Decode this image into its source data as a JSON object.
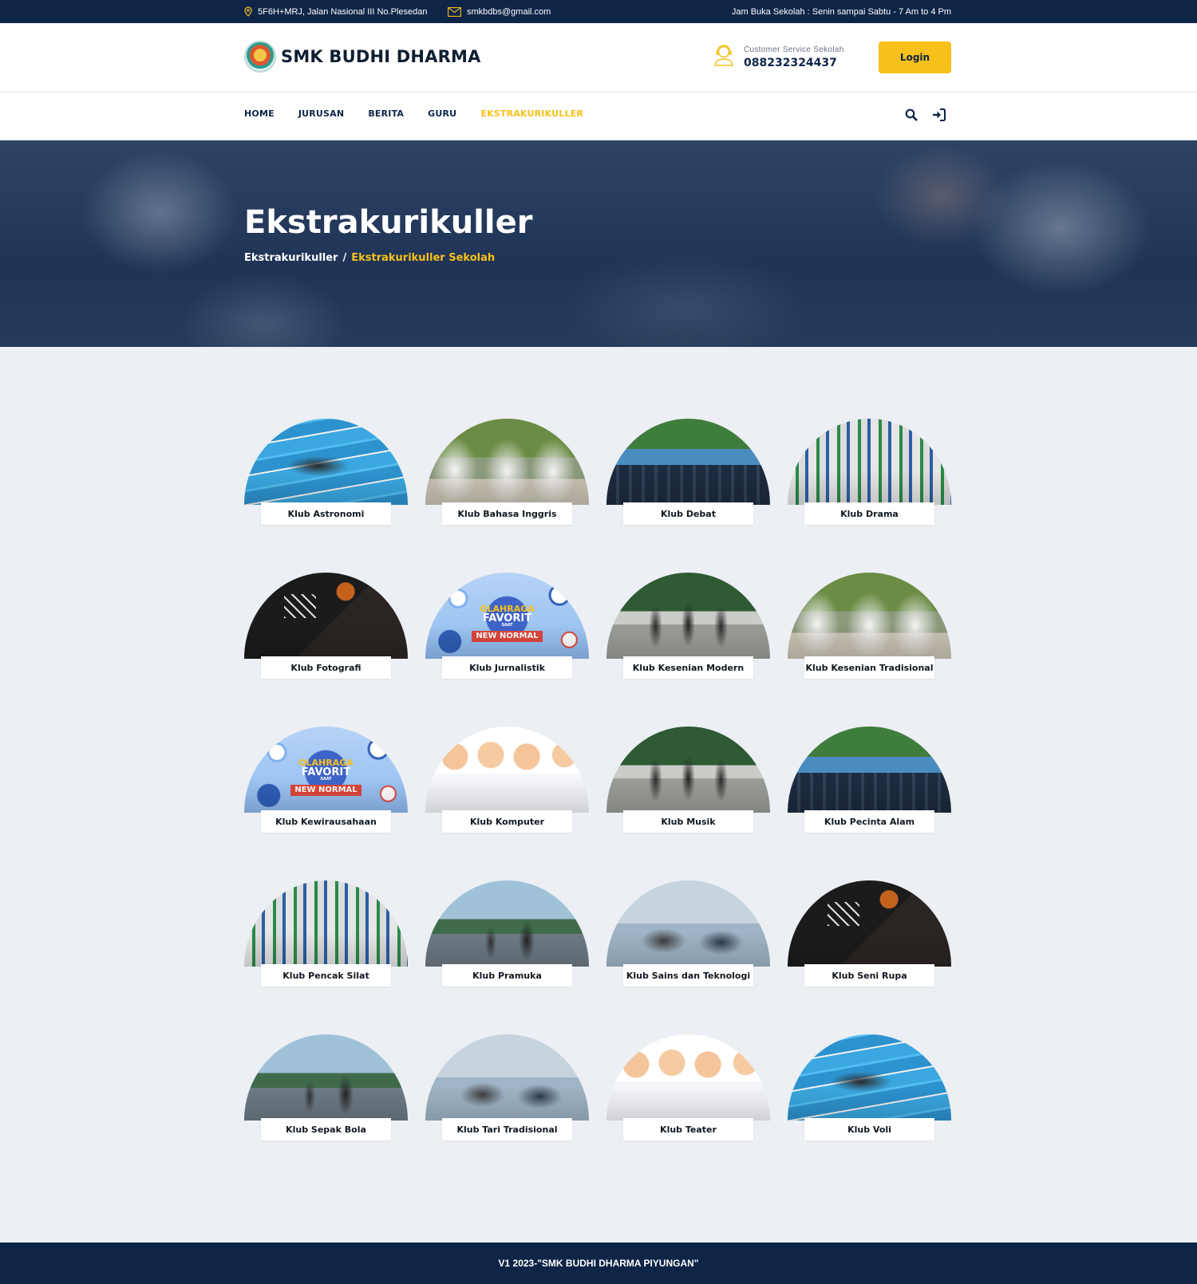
{
  "topbar": {
    "address": "5F6H+MRJ, Jalan Nasional III No.Plesedan",
    "email": "smkbdbs@gmail.com",
    "hours": "Jam Buka Sekolah : Senin sampai Sabtu - 7 Am to 4 Pm"
  },
  "brand": {
    "name": "SMK BUDHI DHARMA"
  },
  "customer_service": {
    "label": "Customer Service Sekolah",
    "phone": "088232324437"
  },
  "header": {
    "login_label": "Login"
  },
  "nav": {
    "items": [
      {
        "label": "HOME",
        "active": false
      },
      {
        "label": "JURUSAN",
        "active": false
      },
      {
        "label": "BERITA",
        "active": false
      },
      {
        "label": "GURU",
        "active": false
      },
      {
        "label": "EKSTRAKURIKULLER",
        "active": true
      }
    ]
  },
  "hero": {
    "title": "Ekstrakurikuller",
    "breadcrumb": {
      "parent": "Ekstrakurikuller",
      "separator": "/",
      "current": "Ekstrakurikuller Sekolah"
    }
  },
  "clubs": [
    {
      "name": "Klub Astronomi",
      "image": "swimming"
    },
    {
      "name": "Klub Bahasa Inggris",
      "image": "martial-arts"
    },
    {
      "name": "Klub Debat",
      "image": "team-photo"
    },
    {
      "name": "Klub Drama",
      "image": "celebration"
    },
    {
      "name": "Klub Fotografi",
      "image": "basketball"
    },
    {
      "name": "Klub Jurnalistik",
      "image": "sports-poster"
    },
    {
      "name": "Klub Kesenian Modern",
      "image": "running"
    },
    {
      "name": "Klub Kesenian Tradisional",
      "image": "martial-arts"
    },
    {
      "name": "Klub Kewirausahaan",
      "image": "sports-poster"
    },
    {
      "name": "Klub Komputer",
      "image": "cartoon-kids"
    },
    {
      "name": "Klub Musik",
      "image": "running"
    },
    {
      "name": "Klub Pecinta Alam",
      "image": "team-photo"
    },
    {
      "name": "Klub Pencak Silat",
      "image": "celebration"
    },
    {
      "name": "Klub Pramuka",
      "image": "outdoor-court"
    },
    {
      "name": "Klub Sains dan Teknologi",
      "image": "stretching"
    },
    {
      "name": "Klub Seni Rupa",
      "image": "basketball"
    },
    {
      "name": "Klub Sepak Bola",
      "image": "outdoor-court"
    },
    {
      "name": "Klub Tari Tradisional",
      "image": "stretching"
    },
    {
      "name": "Klub Teater",
      "image": "cartoon-kids"
    },
    {
      "name": "Klub Voli",
      "image": "swimming"
    }
  ],
  "poster_text": {
    "line1": "OLAHRAGA",
    "line2": "FAVORIT",
    "line3": "SAAT",
    "line4": "NEW NORMAL"
  },
  "colors": {
    "navy": "#0f2548",
    "accent": "#f7c01a",
    "page_bg": "#eceff3"
  },
  "footer": {
    "text": "V1 2023-\"SMK BUDHI DHARMA PIYUNGAN\""
  }
}
